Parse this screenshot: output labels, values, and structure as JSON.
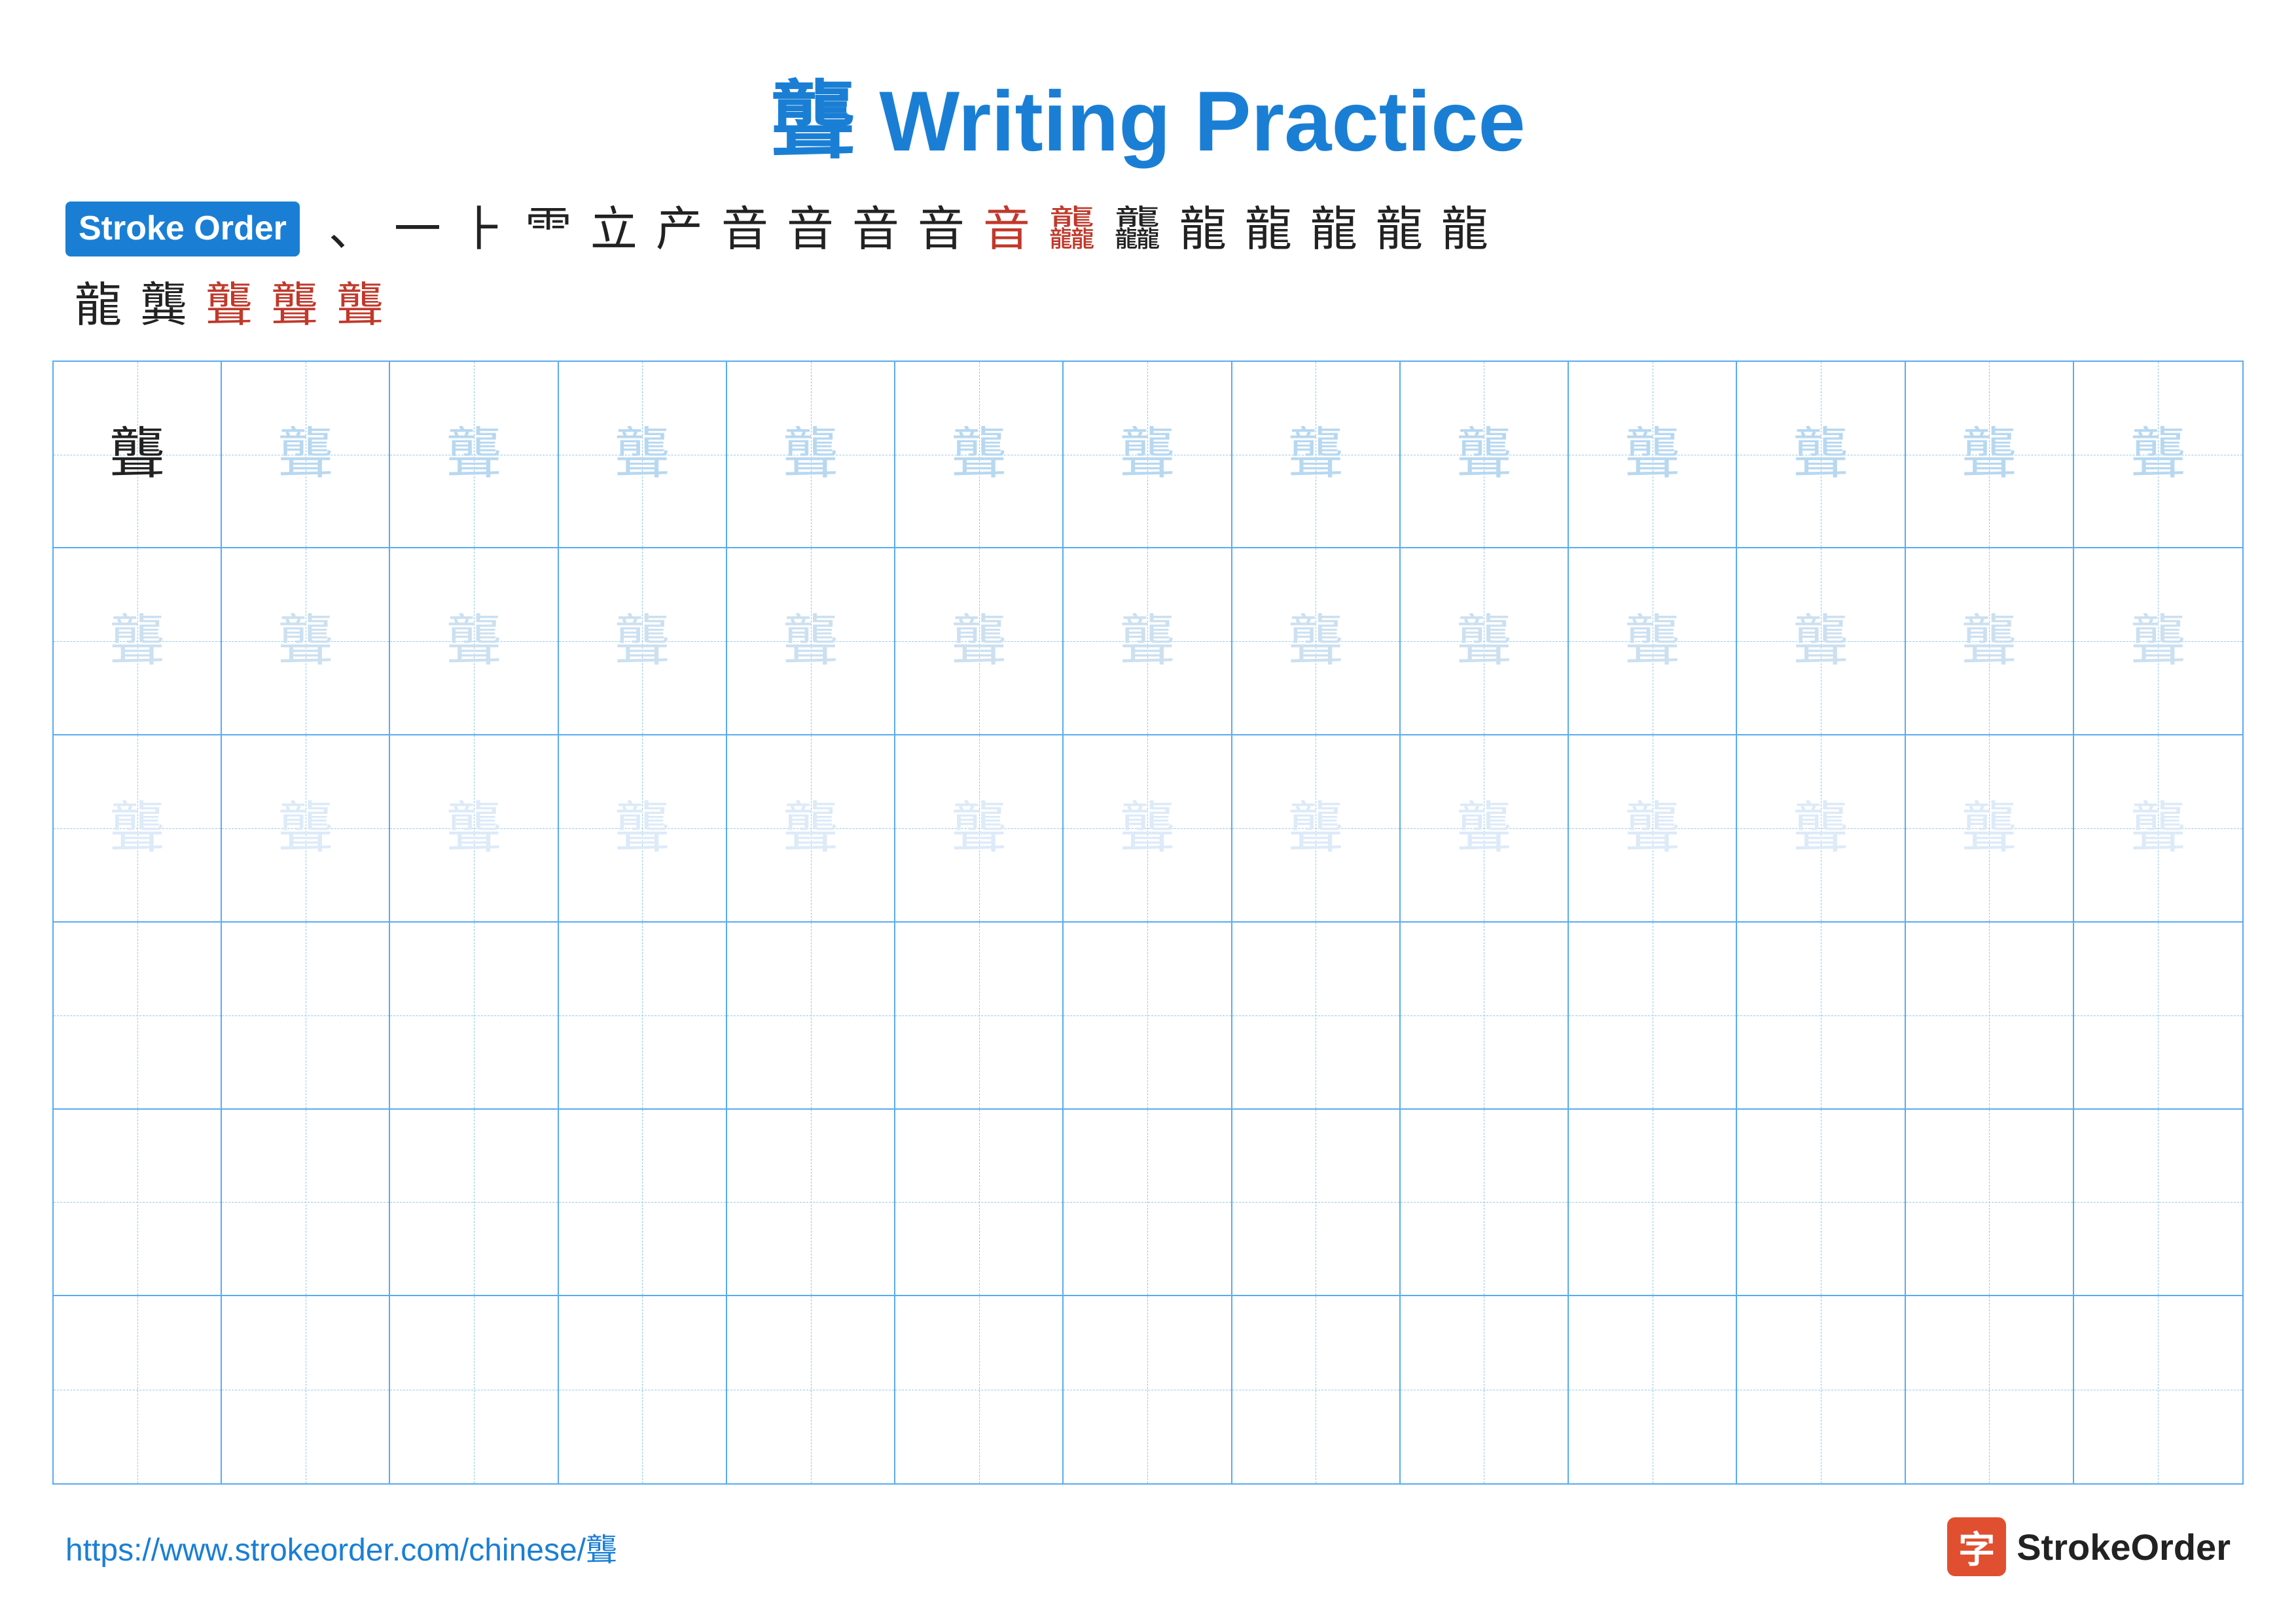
{
  "title": {
    "chinese_char": "聾",
    "label": "Writing Practice",
    "full": "聾 Writing Practice"
  },
  "stroke_order": {
    "badge_label": "Stroke Order",
    "strokes_row1": [
      "、",
      "一",
      "⺊",
      "⻗",
      "立",
      "产",
      "音",
      "音",
      "音",
      "音̄",
      "音⁵",
      "龘",
      "龘",
      "龍",
      "龍",
      "龍",
      "龍",
      "龍"
    ],
    "strokes_row2": [
      "龍",
      "龔",
      "聾",
      "聾",
      "聾"
    ],
    "main_char": "聾"
  },
  "grid": {
    "rows": 6,
    "cols": 13,
    "dark_char": "聾",
    "guide_char": "聾"
  },
  "footer": {
    "url": "https://www.strokeorder.com/chinese/聾",
    "logo_icon_char": "字",
    "logo_name": "StrokeOrder"
  }
}
